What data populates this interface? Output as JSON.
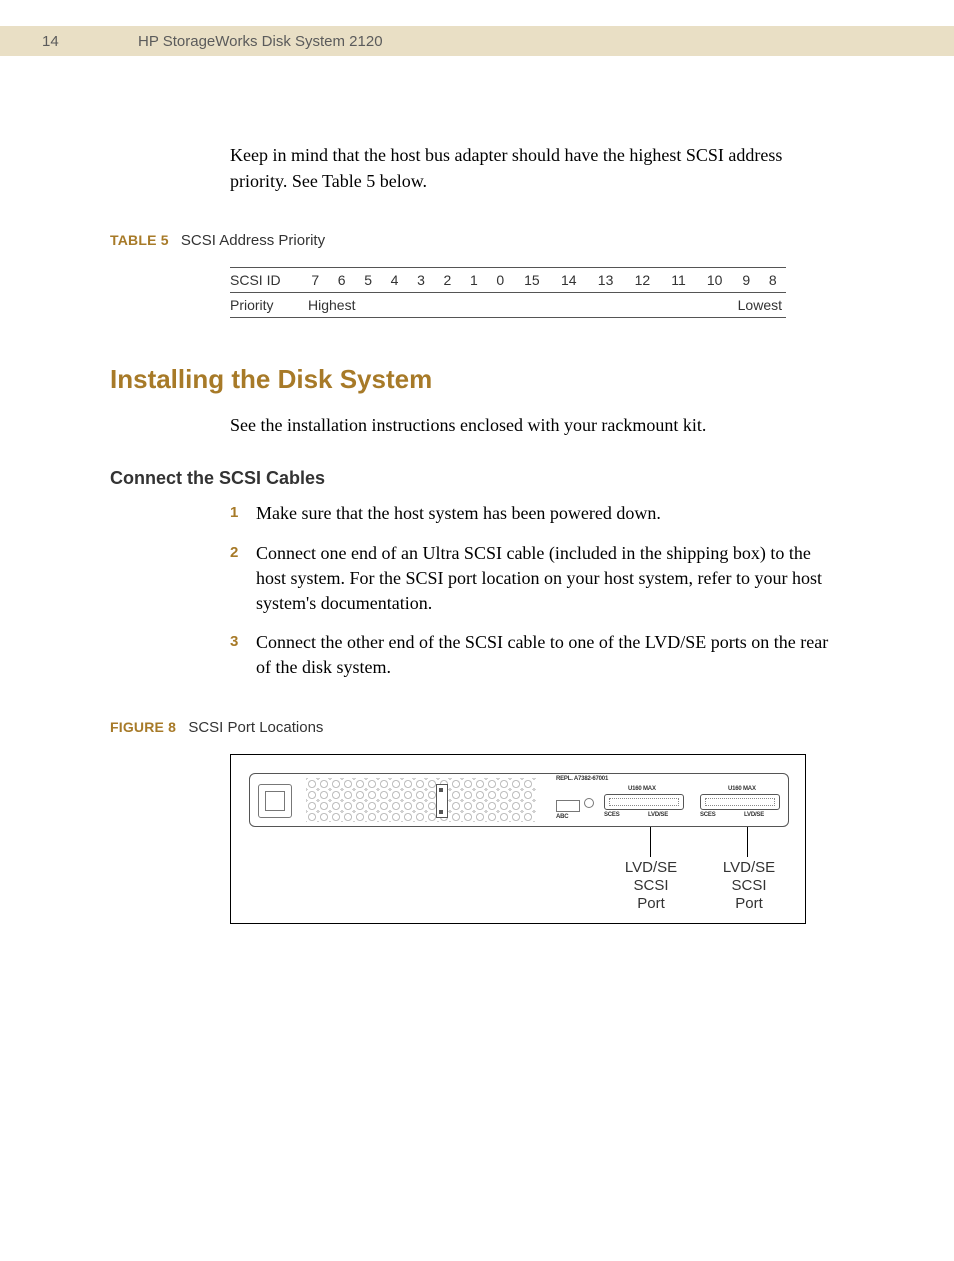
{
  "header": {
    "page_number": "14",
    "doc_title": "HP StorageWorks Disk System 2120"
  },
  "intro_para": "Keep in mind that the host bus adapter should have the highest SCSI address priority. See Table 5 below.",
  "table5": {
    "label": "TABLE 5",
    "caption": "SCSI Address Priority",
    "row1_label": "SCSI ID",
    "ids": [
      "7",
      "6",
      "5",
      "4",
      "3",
      "2",
      "1",
      "0",
      "15",
      "14",
      "13",
      "12",
      "11",
      "10",
      "9",
      "8"
    ],
    "row2_label": "Priority",
    "highest": "Highest",
    "lowest": "Lowest"
  },
  "section_heading": "Installing the Disk System",
  "section_intro": "See the installation instructions enclosed with your rackmount kit.",
  "subsection_heading": "Connect the SCSI Cables",
  "steps": [
    "Make sure that the host system has been powered down.",
    "Connect one end of an Ultra SCSI cable (included in the shipping box) to the host system. For the SCSI port location on your host system, refer to your host system's documentation.",
    "Connect the other end of the SCSI cable to one of the LVD/SE ports on the rear of the disk system."
  ],
  "step_numbers": [
    "1",
    "2",
    "3"
  ],
  "figure8": {
    "label": "FIGURE 8",
    "caption": "SCSI Port Locations",
    "panel": {
      "repl": "REPL. A7382-67001",
      "abc": "ABC",
      "u160": "U160 MAX",
      "sces": "SCES",
      "lvdse": "LVD/SE"
    },
    "callout": "LVD/SE\nSCSI\nPort"
  }
}
